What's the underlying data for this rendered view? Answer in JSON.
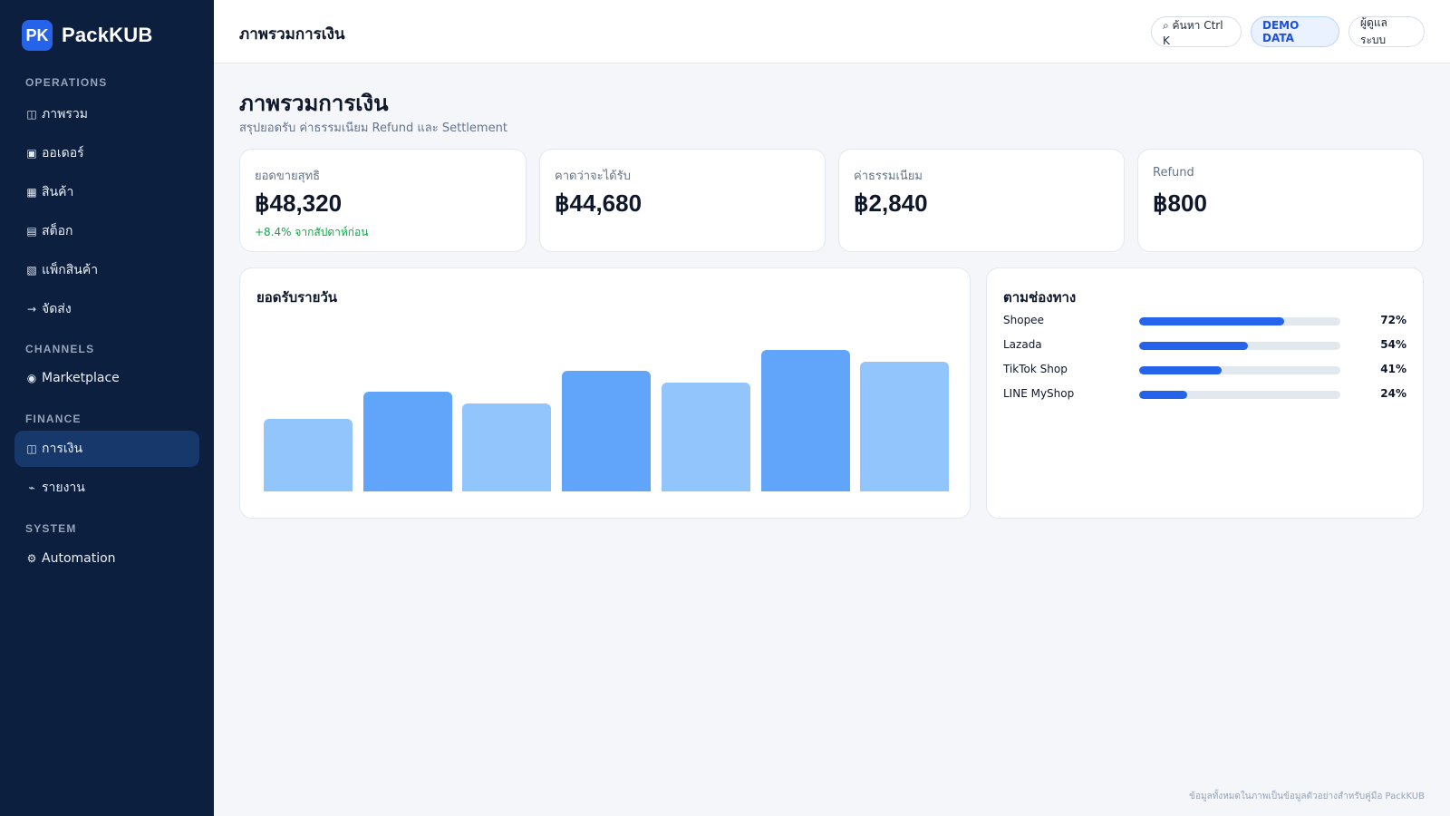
{
  "brand": {
    "logo": "PK",
    "name": "PackKUB"
  },
  "sidebar": {
    "sections": {
      "operations": "OPERATIONS",
      "channels": "CHANNELS",
      "finance": "FINANCE",
      "system": "SYSTEM"
    },
    "items": [
      {
        "icon": "◫",
        "icon_name": "overview-icon",
        "label": "ภาพรวม"
      },
      {
        "icon": "▣",
        "icon_name": "orders-icon",
        "label": "ออเดอร์"
      },
      {
        "icon": "▦",
        "icon_name": "products-icon",
        "label": "สินค้า"
      },
      {
        "icon": "▤",
        "icon_name": "stock-icon",
        "label": "สต็อก"
      },
      {
        "icon": "▧",
        "icon_name": "packing-icon",
        "label": "แพ็กสินค้า"
      },
      {
        "icon": "→",
        "icon_name": "shipping-arrow-icon",
        "label": "จัดส่ง"
      },
      {
        "icon": "◉",
        "icon_name": "marketplace-icon",
        "label": "Marketplace"
      },
      {
        "icon": "◫",
        "icon_name": "finance-icon",
        "label": "การเงิน"
      },
      {
        "icon": "⌁",
        "icon_name": "report-icon",
        "label": "รายงาน"
      },
      {
        "icon": "⚙",
        "icon_name": "gear-icon",
        "label": "Automation"
      }
    ],
    "active_item": "การเงิน"
  },
  "topbar": {
    "title": "ภาพรวมการเงิน",
    "search_label": "⌕ ค้นหา Ctrl K",
    "demo_label": "DEMO DATA",
    "user_label": "ผู้ดูแลระบบ"
  },
  "page": {
    "title": "ภาพรวมการเงิน",
    "subtitle": "สรุปยอดรับ ค่าธรรมเนียม Refund และ Settlement"
  },
  "kpis": [
    {
      "label": "ยอดขายสุทธิ",
      "value": "฿48,320",
      "change": "+8.4% จากสัปดาห์ก่อน"
    },
    {
      "label": "คาดว่าจะได้รับ",
      "value": "฿44,680"
    },
    {
      "label": "ค่าธรรมเนียม",
      "value": "฿2,840"
    },
    {
      "label": "Refund",
      "value": "฿800"
    }
  ],
  "daily_panel": {
    "title": "ยอดรับรายวัน"
  },
  "chart_data": {
    "type": "bar",
    "title": "ยอดรับรายวัน",
    "values": [
      42,
      58,
      51,
      70,
      63,
      82,
      75
    ],
    "ylim": [
      0,
      100
    ],
    "colors": [
      "#93c5fd",
      "#60a5fa",
      "#93c5fd",
      "#60a5fa",
      "#93c5fd",
      "#60a5fa",
      "#93c5fd"
    ],
    "grid": false
  },
  "channels_panel": {
    "title": "ตามช่องทาง",
    "rows": [
      {
        "name": "Shopee",
        "pct": "72%",
        "value": 72
      },
      {
        "name": "Lazada",
        "pct": "54%",
        "value": 54
      },
      {
        "name": "TikTok Shop",
        "pct": "41%",
        "value": 41
      },
      {
        "name": "LINE MyShop",
        "pct": "24%",
        "value": 24
      }
    ]
  },
  "footer": {
    "note": "ข้อมูลทั้งหมดในภาพเป็นข้อมูลตัวอย่างสำหรับคู่มือ PackKUB"
  },
  "colors": {
    "sidebar": "#0d1f3f",
    "accent": "#2563eb",
    "positive": "#16a34a"
  }
}
